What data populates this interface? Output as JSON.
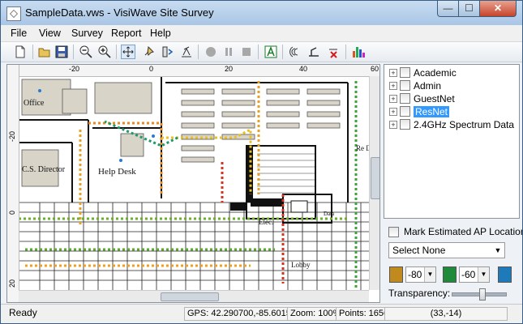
{
  "window": {
    "title": "SampleData.vws - VisiWave Site Survey",
    "minimize_glyph": "—",
    "maximize_glyph": "☐",
    "close_glyph": "✕"
  },
  "menu": [
    "File",
    "View",
    "Survey",
    "Report",
    "Help"
  ],
  "toolbar_icons": [
    "new-file-icon",
    "open-folder-icon",
    "save-icon",
    "zoom-out-icon",
    "zoom-in-icon",
    "move-icon",
    "pin-icon",
    "walk-survey-icon",
    "gps-survey-icon",
    "record-icon",
    "pause-icon",
    "stop-icon",
    "text-annotate-icon",
    "signal-icon",
    "tool-icon",
    "delete-point-icon",
    "bar-chart-icon"
  ],
  "ruler": {
    "top_labels": [
      "-20",
      "0",
      "20",
      "40",
      "60"
    ],
    "left_labels": [
      "-20",
      "0",
      "20"
    ]
  },
  "map": {
    "labels": {
      "office": "Office",
      "director": "C.S. Director",
      "helpdesk": "Help Desk",
      "elec": "Elec.",
      "data": "Data",
      "lobby": "Lobby",
      "red": "Re De"
    }
  },
  "tree": {
    "items": [
      {
        "label": "Academic",
        "selected": false
      },
      {
        "label": "Admin",
        "selected": false
      },
      {
        "label": "GuestNet",
        "selected": false
      },
      {
        "label": "ResNet",
        "selected": true
      },
      {
        "label": "2.4GHz Spectrum Data",
        "selected": false
      }
    ]
  },
  "controls": {
    "mark_estimated_label": "Mark Estimated AP Locations",
    "select_value": "Select None",
    "threshold_1": "-80",
    "threshold_2": "-60",
    "transparency_label": "Transparency:",
    "transparency_level": 0.6,
    "swatch_colors": [
      "#c08a1e",
      "#1e8a3a",
      "#1e7ab8"
    ]
  },
  "status": {
    "ready": "Ready",
    "gps": "GPS: 42.290700,-85.601509",
    "zoom": "Zoom: 100%",
    "points": "Points: 1656",
    "coords": "(33,-14)"
  }
}
